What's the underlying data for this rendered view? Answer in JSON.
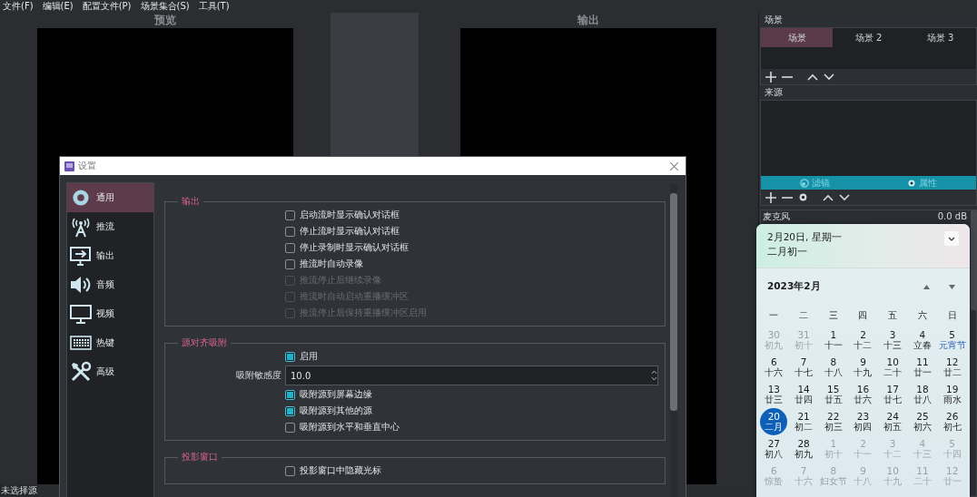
{
  "menu": [
    "文件(F)",
    "编辑(E)",
    "配置文件(P)",
    "场景集合(S)",
    "工具(T)"
  ],
  "preview": {
    "label": "预览"
  },
  "program": {
    "label": "输出"
  },
  "scenes": {
    "title": "场景",
    "tabs": [
      {
        "label": "场景",
        "selected": true
      },
      {
        "label": "场景 2",
        "selected": false
      },
      {
        "label": "场景 3",
        "selected": false
      }
    ]
  },
  "sources": {
    "title": "来源",
    "actions": [
      {
        "label": "滤镜",
        "kind": "filters"
      },
      {
        "label": "属性",
        "kind": "properties"
      }
    ]
  },
  "mixer": {
    "name": "麦克风",
    "reading": "0.0 dB"
  },
  "status_bar": "未选择源",
  "settings": {
    "title": "设置",
    "nav": [
      {
        "label": "通用",
        "selected": true
      },
      {
        "label": "推流",
        "selected": false
      },
      {
        "label": "输出",
        "selected": false
      },
      {
        "label": "音频",
        "selected": false
      },
      {
        "label": "视频",
        "selected": false
      },
      {
        "label": "热键",
        "selected": false
      },
      {
        "label": "高级",
        "selected": false
      }
    ],
    "groups": [
      {
        "title": "输出",
        "items": [
          {
            "kind": "checkbox",
            "label": "启动流时显示确认对话框",
            "checked": false,
            "disabled": false
          },
          {
            "kind": "checkbox",
            "label": "停止流时显示确认对话框",
            "checked": false,
            "disabled": false
          },
          {
            "kind": "checkbox",
            "label": "停止录制时显示确认对话框",
            "checked": false,
            "disabled": false
          },
          {
            "kind": "checkbox",
            "label": "推流时自动录像",
            "checked": false,
            "disabled": false
          },
          {
            "kind": "checkbox",
            "label": "推流停止后继续录像",
            "checked": false,
            "disabled": true
          },
          {
            "kind": "checkbox",
            "label": "推流时自动启动重播缓冲区",
            "checked": false,
            "disabled": true
          },
          {
            "kind": "checkbox",
            "label": "推流停止后保持重播缓冲区启用",
            "checked": false,
            "disabled": true
          }
        ]
      },
      {
        "title": "源对齐吸附",
        "items": [
          {
            "kind": "checkbox",
            "label": "启用",
            "checked": true,
            "disabled": false
          },
          {
            "kind": "spinbox",
            "label": "吸附敏感度",
            "value": "10.0"
          },
          {
            "kind": "checkbox",
            "label": "吸附源到屏幕边缘",
            "checked": true,
            "disabled": false
          },
          {
            "kind": "checkbox",
            "label": "吸附源到其他的源",
            "checked": true,
            "disabled": false
          },
          {
            "kind": "checkbox",
            "label": "吸附源到水平和垂直中心",
            "checked": false,
            "disabled": false
          }
        ]
      },
      {
        "title": "投影窗口",
        "items": [
          {
            "kind": "checkbox",
            "label": "投影窗口中隐藏光标",
            "checked": false,
            "disabled": false
          }
        ]
      }
    ]
  },
  "calendar": {
    "date": "2月20日, 星期一",
    "lunar": "二月初一",
    "month": "2023年2月",
    "weekdays": [
      "一",
      "二",
      "三",
      "四",
      "五",
      "六",
      "日"
    ],
    "days": [
      {
        "day": "30",
        "lunar": "初九",
        "in_month": false,
        "selected": false,
        "festival": false
      },
      {
        "day": "31",
        "lunar": "初十",
        "in_month": false,
        "selected": false,
        "festival": false
      },
      {
        "day": "1",
        "lunar": "十一",
        "in_month": true,
        "selected": false,
        "festival": false
      },
      {
        "day": "2",
        "lunar": "十二",
        "in_month": true,
        "selected": false,
        "festival": false
      },
      {
        "day": "3",
        "lunar": "十三",
        "in_month": true,
        "selected": false,
        "festival": false
      },
      {
        "day": "4",
        "lunar": "立春",
        "in_month": true,
        "selected": false,
        "festival": false
      },
      {
        "day": "5",
        "lunar": "元宵节",
        "in_month": true,
        "selected": false,
        "festival": true
      },
      {
        "day": "6",
        "lunar": "十六",
        "in_month": true,
        "selected": false,
        "festival": false
      },
      {
        "day": "7",
        "lunar": "十七",
        "in_month": true,
        "selected": false,
        "festival": false
      },
      {
        "day": "8",
        "lunar": "十八",
        "in_month": true,
        "selected": false,
        "festival": false
      },
      {
        "day": "9",
        "lunar": "十九",
        "in_month": true,
        "selected": false,
        "festival": false
      },
      {
        "day": "10",
        "lunar": "二十",
        "in_month": true,
        "selected": false,
        "festival": false
      },
      {
        "day": "11",
        "lunar": "廿一",
        "in_month": true,
        "selected": false,
        "festival": false
      },
      {
        "day": "12",
        "lunar": "廿二",
        "in_month": true,
        "selected": false,
        "festival": false
      },
      {
        "day": "13",
        "lunar": "廿三",
        "in_month": true,
        "selected": false,
        "festival": false
      },
      {
        "day": "14",
        "lunar": "廿四",
        "in_month": true,
        "selected": false,
        "festival": false
      },
      {
        "day": "15",
        "lunar": "廿五",
        "in_month": true,
        "selected": false,
        "festival": false
      },
      {
        "day": "16",
        "lunar": "廿六",
        "in_month": true,
        "selected": false,
        "festival": false
      },
      {
        "day": "17",
        "lunar": "廿七",
        "in_month": true,
        "selected": false,
        "festival": false
      },
      {
        "day": "18",
        "lunar": "廿八",
        "in_month": true,
        "selected": false,
        "festival": false
      },
      {
        "day": "19",
        "lunar": "雨水",
        "in_month": true,
        "selected": false,
        "festival": false
      },
      {
        "day": "20",
        "lunar": "二月",
        "in_month": true,
        "selected": true,
        "festival": false
      },
      {
        "day": "21",
        "lunar": "初二",
        "in_month": true,
        "selected": false,
        "festival": false
      },
      {
        "day": "22",
        "lunar": "初三",
        "in_month": true,
        "selected": false,
        "festival": false
      },
      {
        "day": "23",
        "lunar": "初四",
        "in_month": true,
        "selected": false,
        "festival": false
      },
      {
        "day": "24",
        "lunar": "初五",
        "in_month": true,
        "selected": false,
        "festival": false
      },
      {
        "day": "25",
        "lunar": "初六",
        "in_month": true,
        "selected": false,
        "festival": false
      },
      {
        "day": "26",
        "lunar": "初七",
        "in_month": true,
        "selected": false,
        "festival": false
      },
      {
        "day": "27",
        "lunar": "初八",
        "in_month": true,
        "selected": false,
        "festival": false
      },
      {
        "day": "28",
        "lunar": "初九",
        "in_month": true,
        "selected": false,
        "festival": false
      },
      {
        "day": "1",
        "lunar": "初十",
        "in_month": false,
        "selected": false,
        "festival": false
      },
      {
        "day": "2",
        "lunar": "十一",
        "in_month": false,
        "selected": false,
        "festival": false
      },
      {
        "day": "3",
        "lunar": "十二",
        "in_month": false,
        "selected": false,
        "festival": false
      },
      {
        "day": "4",
        "lunar": "十三",
        "in_month": false,
        "selected": false,
        "festival": false
      },
      {
        "day": "5",
        "lunar": "十四",
        "in_month": false,
        "selected": false,
        "festival": false
      },
      {
        "day": "6",
        "lunar": "惊蛰",
        "in_month": false,
        "selected": false,
        "festival": false
      },
      {
        "day": "7",
        "lunar": "十六",
        "in_month": false,
        "selected": false,
        "festival": false
      },
      {
        "day": "8",
        "lunar": "妇女节",
        "in_month": false,
        "selected": false,
        "festival": false
      },
      {
        "day": "9",
        "lunar": "十八",
        "in_month": false,
        "selected": false,
        "festival": false
      },
      {
        "day": "10",
        "lunar": "十九",
        "in_month": false,
        "selected": false,
        "festival": false
      },
      {
        "day": "11",
        "lunar": "二十",
        "in_month": false,
        "selected": false,
        "festival": false
      },
      {
        "day": "12",
        "lunar": "廿一",
        "in_month": false,
        "selected": false,
        "festival": false
      }
    ]
  }
}
